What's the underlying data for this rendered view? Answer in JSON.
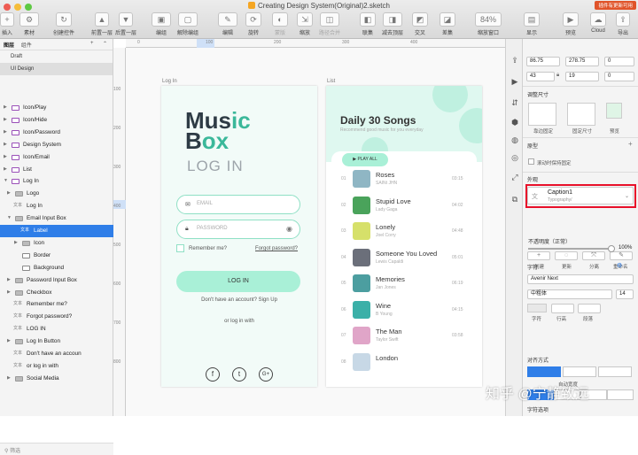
{
  "window": {
    "title": "Creating Design System(Original)2.sketch",
    "update_badge": "插件有更新可用"
  },
  "toolbar": [
    {
      "label": "插入",
      "icon": "+"
    },
    {
      "label": "素材",
      "icon": "⚙"
    },
    {
      "label": "创建控件",
      "icon": "↻"
    },
    {
      "label": "前置一层",
      "icon": "▲"
    },
    {
      "label": "后置一层",
      "icon": "▼"
    },
    {
      "label": "编组",
      "icon": "▣"
    },
    {
      "label": "解除编组",
      "icon": "▢"
    },
    {
      "label": "编辑",
      "icon": "✎"
    },
    {
      "label": "旋转",
      "icon": "⟳"
    },
    {
      "label": "蒙版",
      "icon": "◐"
    },
    {
      "label": "缩放",
      "icon": "⇲"
    },
    {
      "label": "路径合并",
      "icon": "◫"
    },
    {
      "label": "联集",
      "icon": "◧"
    },
    {
      "label": "减去顶层",
      "icon": "◨"
    },
    {
      "label": "交叉",
      "icon": "◩"
    },
    {
      "label": "差集",
      "icon": "◪"
    },
    {
      "label": "缩放窗口",
      "icon": "84%"
    },
    {
      "label": "显示",
      "icon": "▤"
    },
    {
      "label": "预览",
      "icon": "▶"
    },
    {
      "label": "Cloud",
      "icon": "☁"
    },
    {
      "label": "导出",
      "icon": "⇪"
    }
  ],
  "layers_panel": {
    "tabs": [
      "图层",
      "组件"
    ],
    "pages": [
      "Draft",
      "UI Design"
    ],
    "rows": [
      {
        "label": "Icon/Play",
        "type": "artboard"
      },
      {
        "label": "Icon/Hide",
        "type": "artboard"
      },
      {
        "label": "Icon/Password",
        "type": "artboard"
      },
      {
        "label": "Design System",
        "type": "artboard"
      },
      {
        "label": "Icon/Email",
        "type": "artboard"
      },
      {
        "label": "List",
        "type": "artboard"
      },
      {
        "label": "Log  In",
        "type": "artboard",
        "expanded": true
      },
      {
        "label": "Logo",
        "type": "group"
      },
      {
        "label": "Log In",
        "type": "text"
      },
      {
        "label": "Email Input Box",
        "type": "group",
        "expanded": true
      },
      {
        "label": "Label",
        "type": "text",
        "selected": true
      },
      {
        "label": "Icon",
        "type": "group"
      },
      {
        "label": "Border",
        "type": "shape"
      },
      {
        "label": "Background",
        "type": "shape"
      },
      {
        "label": "Password Input Box",
        "type": "group"
      },
      {
        "label": "Checkbox",
        "type": "group"
      },
      {
        "label": "Remember me?",
        "type": "text"
      },
      {
        "label": "Forgot password?",
        "type": "text"
      },
      {
        "label": "LOG IN",
        "type": "text"
      },
      {
        "label": "Log In Button",
        "type": "group"
      },
      {
        "label": "Don't have an accoun",
        "type": "text"
      },
      {
        "label": "or log in with",
        "type": "text"
      },
      {
        "label": "Social Media",
        "type": "group"
      }
    ],
    "filter_label": "筛选"
  },
  "rulers": {
    "top": [
      "0",
      "100",
      "200",
      "300",
      "400"
    ],
    "left": [
      "100",
      "200",
      "300",
      "400",
      "500",
      "600",
      "700",
      "800"
    ]
  },
  "login_artboard": {
    "label": "Log  In",
    "logo_line1_a": "Mus",
    "logo_line1_b": "ic",
    "logo_line2_a": "B",
    "logo_line2_b": "ox",
    "title": "LOG IN",
    "email_placeholder": "EMAIL",
    "password_placeholder": "PASSWORD",
    "remember": "Remember me?",
    "forgot": "Forgot password?",
    "button": "LOG IN",
    "no_account": "Don't have an account? Sign Up",
    "or_log_in": "or log in with",
    "social": [
      "f",
      "t",
      "G+"
    ]
  },
  "list_artboard": {
    "label": "List",
    "title": "Daily 30 Songs",
    "subtitle": "Recommend good music for you everyday",
    "play_all": "▶ PLAY ALL",
    "songs": [
      {
        "num": "01",
        "title": "Roses",
        "artist": "SAINt JHN",
        "dur": "03:15",
        "color": "#8fb6c4"
      },
      {
        "num": "02",
        "title": "Stupid Love",
        "artist": "Lady Gaga",
        "dur": "04:02",
        "color": "#4aa35b"
      },
      {
        "num": "03",
        "title": "Lonely",
        "artist": "Joel Corry",
        "dur": "04:48",
        "color": "#d6e06a"
      },
      {
        "num": "04",
        "title": "Someone You Loved",
        "artist": "Lewis Capaldi",
        "dur": "05:01",
        "color": "#6b6f7a"
      },
      {
        "num": "05",
        "title": "Memories",
        "artist": "Jan Jones",
        "dur": "06:19",
        "color": "#4c9ea0"
      },
      {
        "num": "06",
        "title": "Wine",
        "artist": "B Young",
        "dur": "04:15",
        "color": "#3bb0a8"
      },
      {
        "num": "07",
        "title": "The Man",
        "artist": "Taylor Swift",
        "dur": "03:58",
        "color": "#e0a5c8"
      },
      {
        "num": "08",
        "title": "London",
        "artist": "",
        "dur": "",
        "color": "#c7d8e6"
      }
    ]
  },
  "inspector": {
    "x": "86.75",
    "y": "278.75",
    "rotation": "0",
    "w": "43",
    "h": "19",
    "ratio": "0",
    "resize_title": "调整尺寸",
    "pin_left": "靠边固定",
    "fix_size": "固定尺寸",
    "preview": "预览",
    "prototype": "原型",
    "scroll_fix": "滚动时保持固定",
    "appearance": "外观",
    "style_name": "Caption1",
    "style_sub": "Typography/",
    "style_buttons": [
      "创建",
      "更新",
      "分离",
      "重命名"
    ],
    "opacity_label": "不透明度（正常）",
    "opacity": "100%",
    "text_section": "字符",
    "font": "Avenir Next",
    "weight": "中粗体",
    "size": "14",
    "font_labels": [
      "字符",
      "行高",
      "段落"
    ],
    "align_title": "对齐方式",
    "auto_width": "自动宽度",
    "text_options": "字符选项"
  },
  "watermark": "知乎 @宁静致远"
}
